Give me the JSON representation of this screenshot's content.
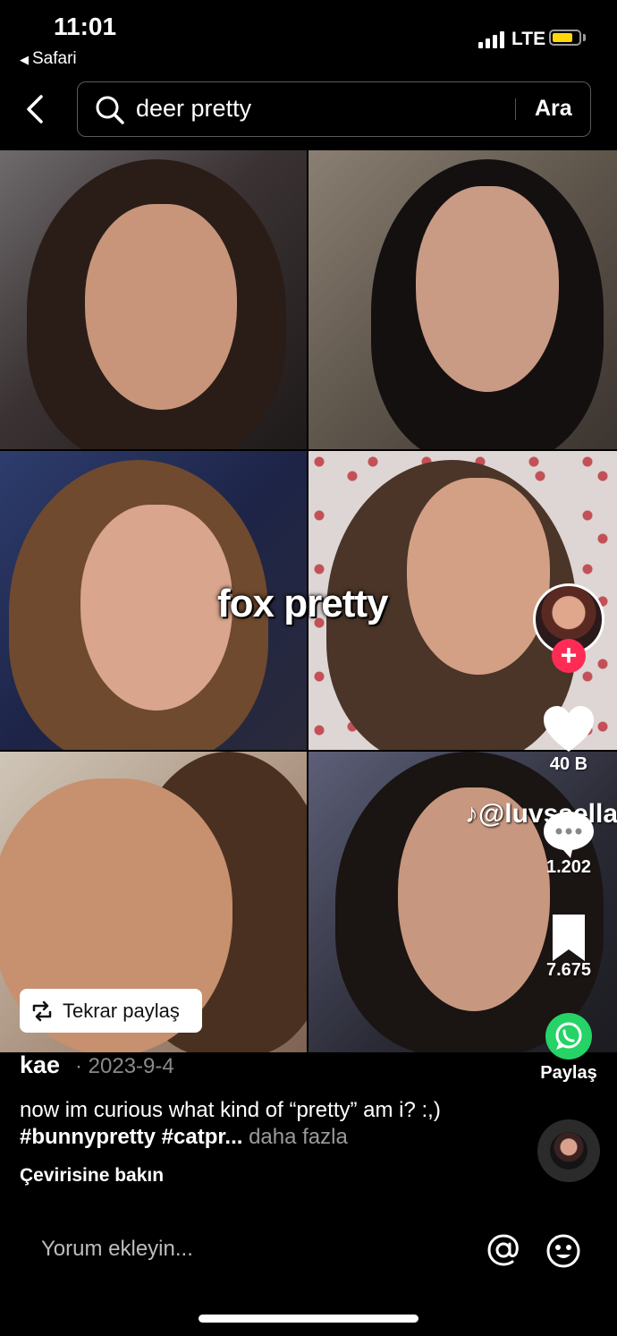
{
  "status_bar": {
    "time": "11:01",
    "back_app": "Safari",
    "network": "LTE"
  },
  "search": {
    "query": "deer pretty",
    "submit_label": "Ara"
  },
  "video": {
    "overlay_text": "fox pretty",
    "watermark": "@luvssella",
    "repost_label": "Tekrar paylaş"
  },
  "actions": {
    "likes": "40 B",
    "comments": "1.202",
    "saves": "7.675",
    "share_label": "Paylaş"
  },
  "post": {
    "author": "kae",
    "date": "· 2023-9-4",
    "caption_text": "now im curious what kind of “pretty” am i?  :,) ",
    "caption_tags": "#bunnypretty #catpr...",
    "more_label": " daha fazla",
    "translate_label": "Çevirisine bakın"
  },
  "comment_bar": {
    "placeholder": "Yorum ekleyin..."
  },
  "colors": {
    "accent_red": "#fe2c55",
    "whatsapp_green": "#25d366",
    "battery_yellow": "#ffd60a"
  }
}
